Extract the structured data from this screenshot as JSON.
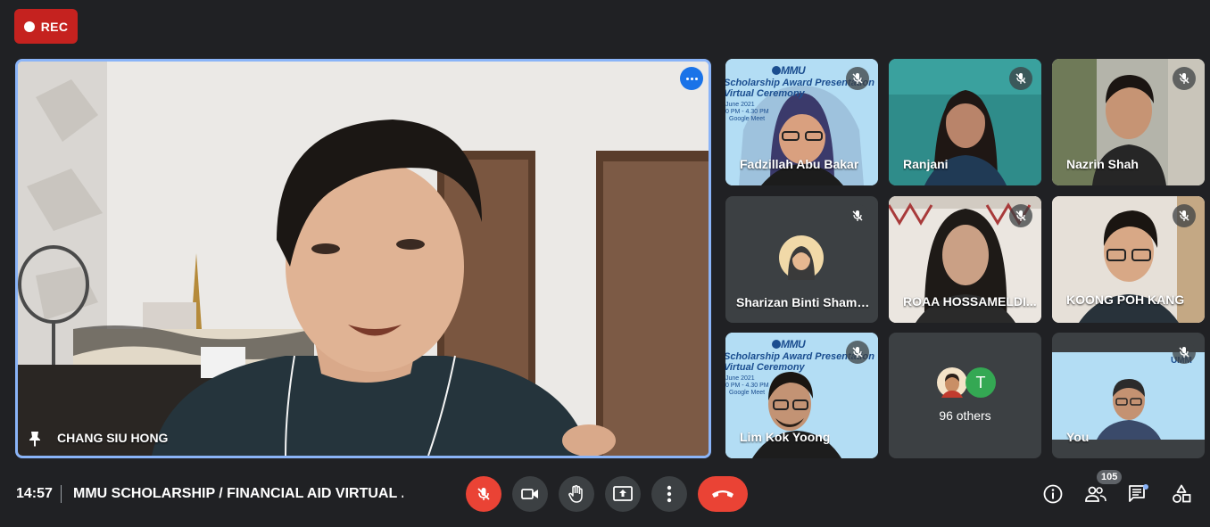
{
  "recording": {
    "label": "REC"
  },
  "main_speaker": {
    "name": "CHANG SIU HONG"
  },
  "tiles": [
    {
      "name": "Fadzillah Abu Bakar",
      "banner_line1": "Scholarship Award Presentation",
      "banner_line2": "Virtual Ceremony",
      "banner_date": "June 2021",
      "banner_time": "0 PM - 4.30 PM",
      "banner_app": "Google Meet"
    },
    {
      "name": "Ranjani"
    },
    {
      "name": "Nazrin Shah"
    },
    {
      "name": "Sharizan Binti Shamsu..."
    },
    {
      "name": "ROAA HOSSAMELDI..."
    },
    {
      "name": "KOONG POH KANG"
    },
    {
      "name": "Lim Kok Yoong",
      "banner_line1": "Scholarship Award Presentation",
      "banner_line2": "Virtual Ceremony",
      "banner_date": "June 2021",
      "banner_time": "0 PM - 4.30 PM",
      "banner_app": "Google Meet"
    },
    {
      "name": "96 others",
      "avatar_letter": "T"
    },
    {
      "name": "You"
    }
  ],
  "logo": {
    "text": "MMU"
  },
  "bottom_bar": {
    "time": "14:57",
    "meeting_title": "MMU SCHOLARSHIP / FINANCIAL AID VIRTUAL ...",
    "participant_count": "105"
  },
  "colors": {
    "accent": "#8ab4f8",
    "danger": "#ea4335",
    "rec": "#c5221f",
    "bar": "#202124",
    "button": "#3c4043",
    "chat_dot": "#8ab4f8",
    "avatar_t": "#34a853"
  }
}
